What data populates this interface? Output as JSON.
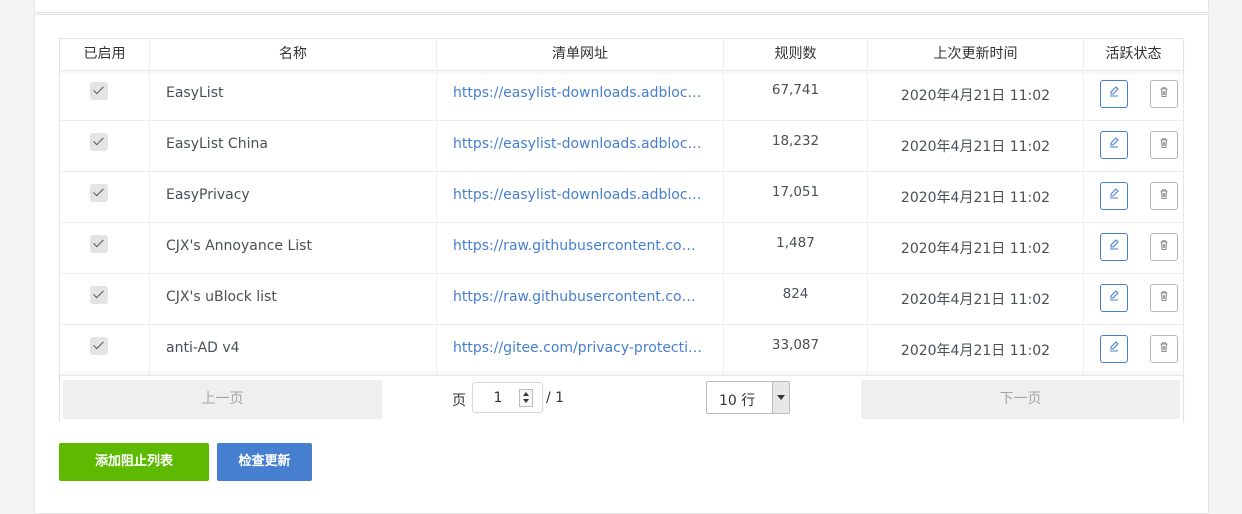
{
  "table": {
    "headers": {
      "enabled": "已启用",
      "name": "名称",
      "url": "清单网址",
      "rules": "规则数",
      "updated": "上次更新时间",
      "actions": "活跃状态"
    },
    "rows": [
      {
        "enabled": true,
        "name": "EasyList",
        "url": "https://easylist-downloads.adblockp...",
        "rules": "67,741",
        "updated": "2020年4月21日 11:02"
      },
      {
        "enabled": true,
        "name": "EasyList China",
        "url": "https://easylist-downloads.adblockp...",
        "rules": "18,232",
        "updated": "2020年4月21日 11:02"
      },
      {
        "enabled": true,
        "name": "EasyPrivacy",
        "url": "https://easylist-downloads.adblockp...",
        "rules": "17,051",
        "updated": "2020年4月21日 11:02"
      },
      {
        "enabled": true,
        "name": "CJX's Annoyance List",
        "url": "https://raw.githubusercontent.com/c...",
        "rules": "1,487",
        "updated": "2020年4月21日 11:02"
      },
      {
        "enabled": true,
        "name": "CJX's uBlock list",
        "url": "https://raw.githubusercontent.com/c...",
        "rules": "824",
        "updated": "2020年4月21日 11:02"
      },
      {
        "enabled": true,
        "name": "anti-AD v4",
        "url": "https://gitee.com/privacy-protection...",
        "rules": "33,087",
        "updated": "2020年4月21日 11:02"
      }
    ]
  },
  "pager": {
    "prev": "上一页",
    "page_label": "页",
    "page_value": "1",
    "page_total": "/ 1",
    "rows_per_page": "10 行",
    "next": "下一页"
  },
  "actions": {
    "add_list": "添加阻止列表",
    "check_updates": "检查更新"
  },
  "colors": {
    "primary": "#467fcf",
    "success": "#5eba00",
    "link": "#467fcf"
  },
  "icons": {
    "edit": "edit-icon",
    "delete": "trash-icon",
    "checkbox": "checkmark-icon"
  }
}
